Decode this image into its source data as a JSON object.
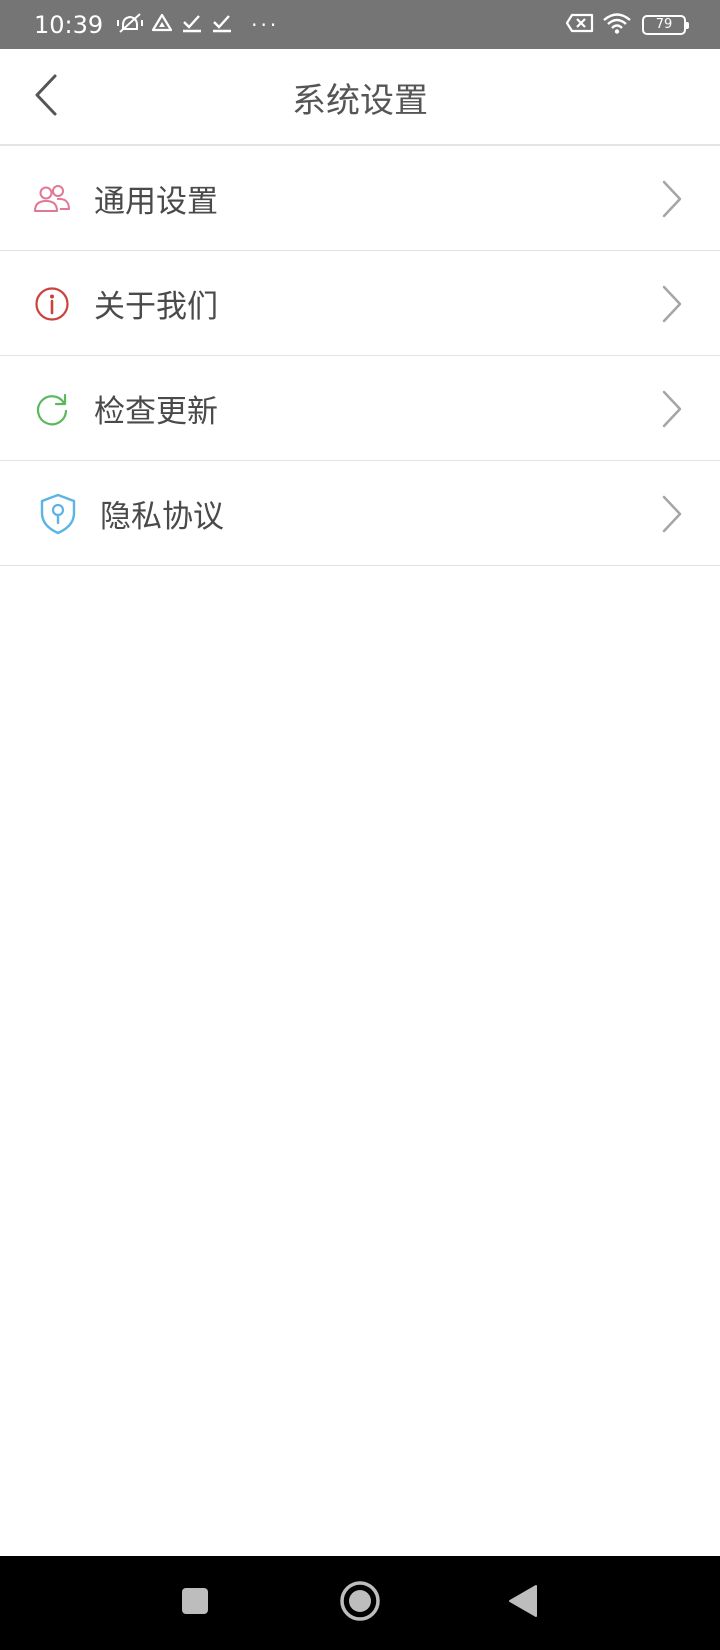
{
  "status_bar": {
    "time": "10:39",
    "battery_level": "79",
    "icons": [
      "vibrate-off-icon",
      "drive-icon",
      "check-icon",
      "check-icon",
      "more-dots-icon",
      "sim-off-icon",
      "wifi-icon",
      "battery-icon"
    ],
    "more": "···"
  },
  "header": {
    "title": "系统设置",
    "back_icon": "chevron-left-icon"
  },
  "menu": {
    "items": [
      {
        "label": "通用设置",
        "icon": "users-icon",
        "color": "#e07896"
      },
      {
        "label": "关于我们",
        "icon": "info-icon",
        "color": "#c9433c"
      },
      {
        "label": "检查更新",
        "icon": "refresh-icon",
        "color": "#5cb85c"
      },
      {
        "label": "隐私协议",
        "icon": "shield-lock-icon",
        "color": "#5bb3e6"
      }
    ],
    "chevron_color": "#a5a5a5"
  },
  "nav_bar": {
    "recents_icon": "square-icon",
    "home_icon": "circle-home-icon",
    "back_icon": "triangle-back-icon"
  }
}
